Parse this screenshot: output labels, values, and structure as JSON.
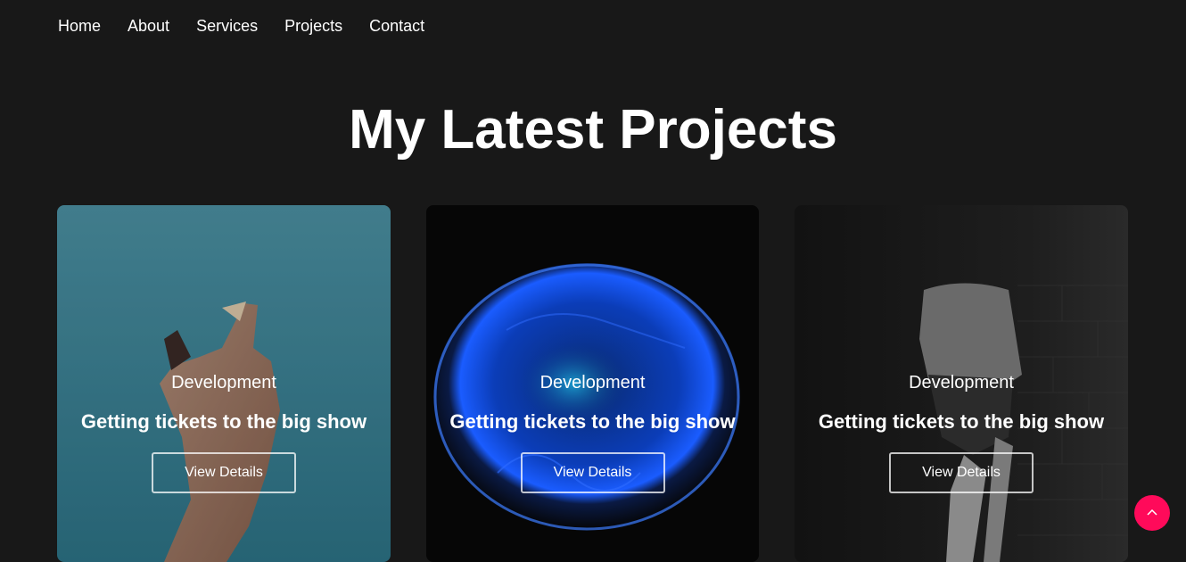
{
  "nav": {
    "items": [
      {
        "label": "Home"
      },
      {
        "label": "About"
      },
      {
        "label": "Services"
      },
      {
        "label": "Projects"
      },
      {
        "label": "Contact"
      }
    ]
  },
  "section": {
    "title": "My Latest Projects"
  },
  "projects": [
    {
      "category": "Development",
      "title": "Getting tickets to the big show",
      "button": "View Details",
      "image": "hand-holding-object-photo"
    },
    {
      "category": "Development",
      "title": "Getting tickets to the big show",
      "button": "View Details",
      "image": "blue-jellyfish-photo"
    },
    {
      "category": "Development",
      "title": "Getting tickets to the big show",
      "button": "View Details",
      "image": "woman-brick-wall-bw-photo"
    }
  ],
  "scroll_top": {
    "icon": "chevron-up-icon",
    "color": "#ff0a5a"
  },
  "colors": {
    "background": "#181818",
    "accent": "#ff0a5a"
  }
}
